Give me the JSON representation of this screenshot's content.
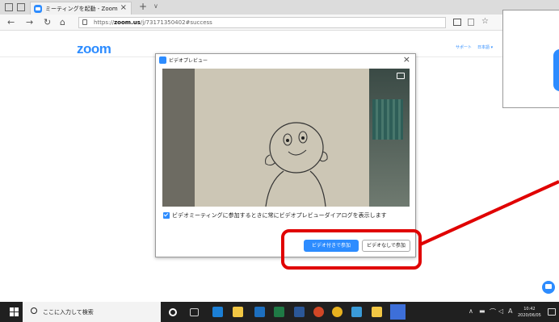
{
  "browser": {
    "tab_title": "ミーティングを起動 - Zoom",
    "tab_close": "×",
    "new_tab": "+",
    "tab_dropdown": "∨",
    "url_prefix": "https://",
    "url_domain": "zoom.us",
    "url_path": "/j/73171350402#success",
    "nav_back": "←",
    "nav_forward": "→",
    "nav_refresh": "↻",
    "nav_home": "⌂",
    "favorite_icon": "☆"
  },
  "page": {
    "logo": "zoom",
    "header_links": [
      "サポート",
      "日本語 ▾"
    ]
  },
  "dialog": {
    "title": "ビデオプレビュー",
    "close": "×",
    "checkbox_label": "ビデオミーティングに参加するときに常にビデオプレビューダイアログを表示します",
    "checkbox_checked": true,
    "join_with_video": "ビデオ付きで参加",
    "join_without_video": "ビデオなしで参加"
  },
  "annotation": {
    "color": "#e00000"
  },
  "taskbar": {
    "search_placeholder": "ここに入力して検索",
    "ime_indicator": "A",
    "time": "10:42",
    "date": "2020/06/05"
  },
  "colors": {
    "accent": "#2d8cff",
    "taskbar": "#202020"
  }
}
